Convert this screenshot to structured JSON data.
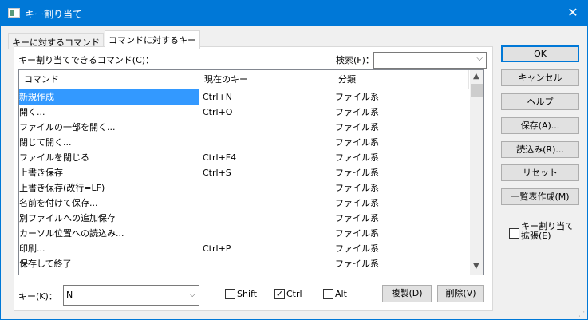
{
  "window": {
    "title": "キー割り当て",
    "close_icon": "close-icon"
  },
  "tabs": [
    {
      "label": "キーに対するコマンド"
    },
    {
      "label": "コマンドに対するキー"
    }
  ],
  "list_label": "キー割り当てできるコマンド(C)：",
  "search": {
    "label": "検索(F)：",
    "value": ""
  },
  "columns": [
    "コマンド",
    "現在のキー",
    "分類"
  ],
  "rows": [
    [
      "新規作成",
      "Ctrl+N",
      "ファイル系"
    ],
    [
      "開く...",
      "Ctrl+O",
      "ファイル系"
    ],
    [
      "ファイルの一部を開く...",
      "",
      "ファイル系"
    ],
    [
      "閉じて開く...",
      "",
      "ファイル系"
    ],
    [
      "ファイルを閉じる",
      "Ctrl+F4",
      "ファイル系"
    ],
    [
      "上書き保存",
      "Ctrl+S",
      "ファイル系"
    ],
    [
      "上書き保存(改行=LF)",
      "",
      "ファイル系"
    ],
    [
      "名前を付けて保存...",
      "",
      "ファイル系"
    ],
    [
      "別ファイルへの追加保存",
      "",
      "ファイル系"
    ],
    [
      "カーソル位置への読込み...",
      "",
      "ファイル系"
    ],
    [
      "印刷...",
      "Ctrl+P",
      "ファイル系"
    ],
    [
      "保存して終了",
      "",
      "ファイル系"
    ]
  ],
  "selected_row": 0,
  "key": {
    "label": "キー(K)：",
    "value": "N"
  },
  "modifiers": {
    "shift": {
      "label": "Shift",
      "checked": false
    },
    "ctrl": {
      "label": "Ctrl",
      "checked": true
    },
    "alt": {
      "label": "Alt",
      "checked": false
    }
  },
  "actions": {
    "duplicate": "複製(D)",
    "delete": "削除(V)"
  },
  "buttons": {
    "ok": "OK",
    "cancel": "キャンセル",
    "help": "ヘルプ",
    "save": "保存(A)...",
    "load": "読込み(R)...",
    "reset": "リセット",
    "list": "一覧表作成(M)"
  },
  "extend": {
    "label": "キー割り当て拡張(E)",
    "checked": false
  }
}
